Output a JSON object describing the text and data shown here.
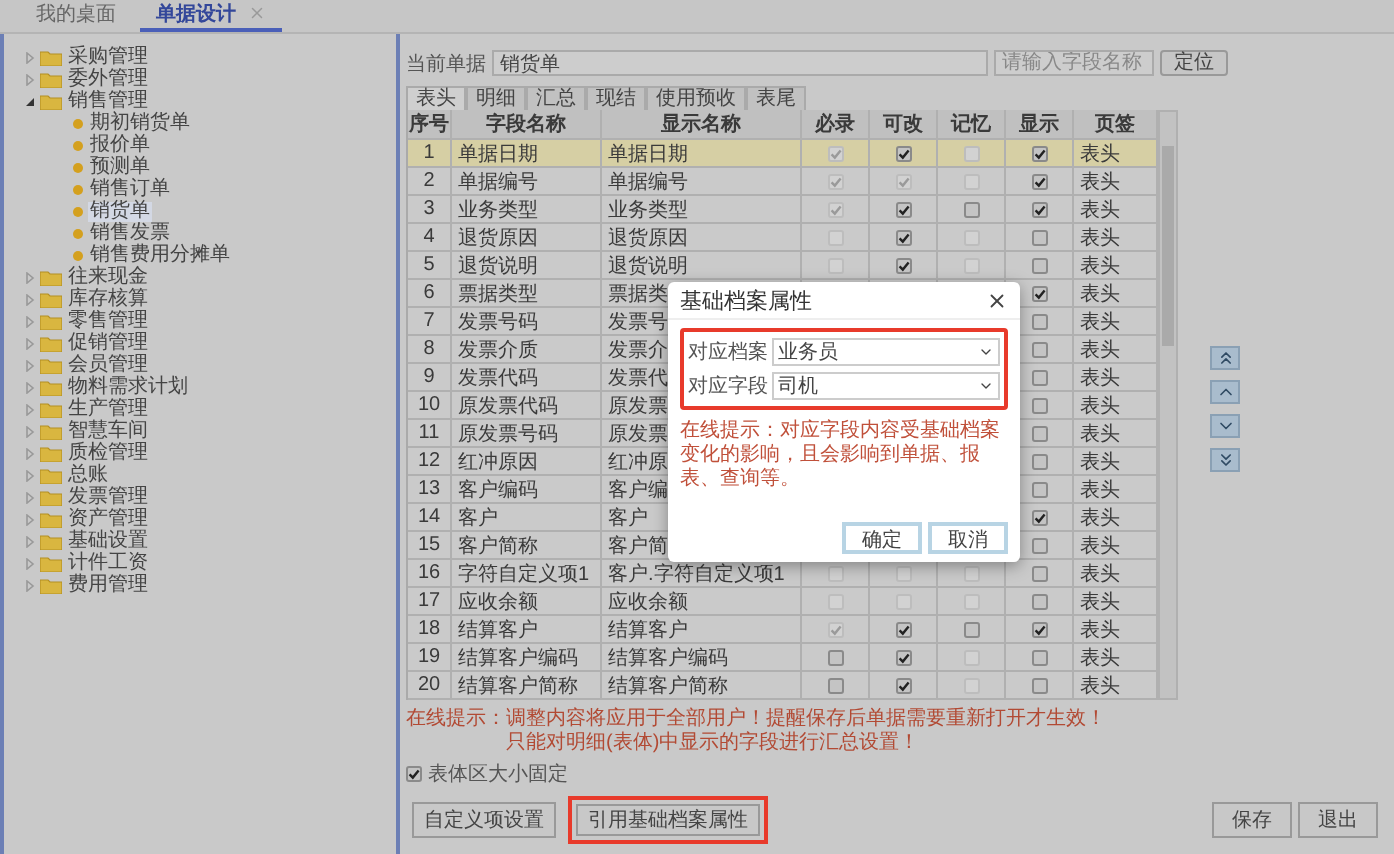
{
  "page_tabs": [
    {
      "label": "我的桌面",
      "selected": false,
      "closable": false
    },
    {
      "label": "单据设计",
      "selected": true,
      "closable": true
    }
  ],
  "tree": [
    {
      "label": "采购管理",
      "kind": "folder",
      "expanded": false
    },
    {
      "label": "委外管理",
      "kind": "folder",
      "expanded": false
    },
    {
      "label": "销售管理",
      "kind": "folder",
      "expanded": true,
      "children": [
        {
          "label": "期初销货单",
          "kind": "document",
          "selected": false
        },
        {
          "label": "报价单",
          "kind": "document",
          "selected": false
        },
        {
          "label": "预测单",
          "kind": "document",
          "selected": false
        },
        {
          "label": "销售订单",
          "kind": "document",
          "selected": false
        },
        {
          "label": "销货单",
          "kind": "document",
          "selected": true
        },
        {
          "label": "销售发票",
          "kind": "document",
          "selected": false
        },
        {
          "label": "销售费用分摊单",
          "kind": "document",
          "selected": false
        }
      ]
    },
    {
      "label": "往来现金",
      "kind": "folder",
      "expanded": false
    },
    {
      "label": "库存核算",
      "kind": "folder",
      "expanded": false
    },
    {
      "label": "零售管理",
      "kind": "folder",
      "expanded": false
    },
    {
      "label": "促销管理",
      "kind": "folder",
      "expanded": false
    },
    {
      "label": "会员管理",
      "kind": "folder",
      "expanded": false
    },
    {
      "label": "物料需求计划",
      "kind": "folder",
      "expanded": false
    },
    {
      "label": "生产管理",
      "kind": "folder",
      "expanded": false
    },
    {
      "label": "智慧车间",
      "kind": "folder",
      "expanded": false
    },
    {
      "label": "质检管理",
      "kind": "folder",
      "expanded": false
    },
    {
      "label": "总账",
      "kind": "folder",
      "expanded": false
    },
    {
      "label": "发票管理",
      "kind": "folder",
      "expanded": false
    },
    {
      "label": "资产管理",
      "kind": "folder",
      "expanded": false
    },
    {
      "label": "基础设置",
      "kind": "folder",
      "expanded": false
    },
    {
      "label": "计件工资",
      "kind": "folder",
      "expanded": false
    },
    {
      "label": "费用管理",
      "kind": "folder",
      "expanded": false
    }
  ],
  "locate": {
    "label": "当前单据",
    "value": "销货单",
    "placeholder": "请输入字段名称",
    "button": "定位"
  },
  "sub_tabs": [
    {
      "label": "表头",
      "selected": true
    },
    {
      "label": "明细",
      "selected": false
    },
    {
      "label": "汇总",
      "selected": false
    },
    {
      "label": "现结",
      "selected": false
    },
    {
      "label": "使用预收",
      "selected": false
    },
    {
      "label": "表尾",
      "selected": false
    }
  ],
  "table": {
    "columns": [
      "序号",
      "字段名称",
      "显示名称",
      "必录",
      "可改",
      "记忆",
      "显示",
      "页签"
    ],
    "rows": [
      {
        "no": "1",
        "field": "单据日期",
        "display": "单据日期",
        "selected": true,
        "required": {
          "checked": true,
          "disabled": true
        },
        "editable": {
          "checked": true,
          "disabled": false
        },
        "memory": {
          "checked": false,
          "disabled": true
        },
        "visible": {
          "checked": true,
          "disabled": false
        },
        "tab": "表头"
      },
      {
        "no": "2",
        "field": "单据编号",
        "display": "单据编号",
        "selected": false,
        "required": {
          "checked": true,
          "disabled": true
        },
        "editable": {
          "checked": true,
          "disabled": true
        },
        "memory": {
          "checked": false,
          "disabled": true
        },
        "visible": {
          "checked": true,
          "disabled": false
        },
        "tab": "表头"
      },
      {
        "no": "3",
        "field": "业务类型",
        "display": "业务类型",
        "selected": false,
        "required": {
          "checked": true,
          "disabled": true
        },
        "editable": {
          "checked": true,
          "disabled": false
        },
        "memory": {
          "checked": false,
          "disabled": false
        },
        "visible": {
          "checked": true,
          "disabled": false
        },
        "tab": "表头"
      },
      {
        "no": "4",
        "field": "退货原因",
        "display": "退货原因",
        "selected": false,
        "required": {
          "checked": false,
          "disabled": true
        },
        "editable": {
          "checked": true,
          "disabled": false
        },
        "memory": {
          "checked": false,
          "disabled": true
        },
        "visible": {
          "checked": false,
          "disabled": false
        },
        "tab": "表头"
      },
      {
        "no": "5",
        "field": "退货说明",
        "display": "退货说明",
        "selected": false,
        "required": {
          "checked": false,
          "disabled": true
        },
        "editable": {
          "checked": true,
          "disabled": false
        },
        "memory": {
          "checked": false,
          "disabled": true
        },
        "visible": {
          "checked": false,
          "disabled": false
        },
        "tab": "表头"
      },
      {
        "no": "6",
        "field": "票据类型",
        "display": "票据类",
        "selected": false,
        "visible": {
          "checked": true,
          "disabled": false
        },
        "tab": "表头"
      },
      {
        "no": "7",
        "field": "发票号码",
        "display": "发票号",
        "selected": false,
        "visible": {
          "checked": false,
          "disabled": false
        },
        "tab": "表头"
      },
      {
        "no": "8",
        "field": "发票介质",
        "display": "发票介",
        "selected": false,
        "visible": {
          "checked": false,
          "disabled": false
        },
        "tab": "表头"
      },
      {
        "no": "9",
        "field": "发票代码",
        "display": "发票代",
        "selected": false,
        "visible": {
          "checked": false,
          "disabled": false
        },
        "tab": "表头"
      },
      {
        "no": "10",
        "field": "原发票代码",
        "display": "原发票",
        "selected": false,
        "visible": {
          "checked": false,
          "disabled": false
        },
        "tab": "表头"
      },
      {
        "no": "11",
        "field": "原发票号码",
        "display": "原发票",
        "selected": false,
        "visible": {
          "checked": false,
          "disabled": false
        },
        "tab": "表头"
      },
      {
        "no": "12",
        "field": "红冲原因",
        "display": "红冲原",
        "selected": false,
        "visible": {
          "checked": false,
          "disabled": false
        },
        "tab": "表头"
      },
      {
        "no": "13",
        "field": "客户编码",
        "display": "客户编",
        "selected": false,
        "visible": {
          "checked": false,
          "disabled": false
        },
        "tab": "表头"
      },
      {
        "no": "14",
        "field": "客户",
        "display": "客户",
        "selected": false,
        "visible": {
          "checked": true,
          "disabled": false
        },
        "tab": "表头"
      },
      {
        "no": "15",
        "field": "客户简称",
        "display": "客户简",
        "selected": false,
        "visible": {
          "checked": false,
          "disabled": false
        },
        "tab": "表头"
      },
      {
        "no": "16",
        "field": "字符自定义项1",
        "display": "客户.字符自定义项1",
        "selected": false,
        "required": {
          "checked": false,
          "disabled": true
        },
        "editable": {
          "checked": false,
          "disabled": true
        },
        "memory": {
          "checked": false,
          "disabled": true
        },
        "visible": {
          "checked": false,
          "disabled": false
        },
        "tab": "表头"
      },
      {
        "no": "17",
        "field": "应收余额",
        "display": "应收余额",
        "selected": false,
        "required": {
          "checked": false,
          "disabled": true
        },
        "editable": {
          "checked": false,
          "disabled": true
        },
        "memory": {
          "checked": false,
          "disabled": true
        },
        "visible": {
          "checked": false,
          "disabled": false
        },
        "tab": "表头"
      },
      {
        "no": "18",
        "field": "结算客户",
        "display": "结算客户",
        "selected": false,
        "required": {
          "checked": true,
          "disabled": true
        },
        "editable": {
          "checked": true,
          "disabled": false
        },
        "memory": {
          "checked": false,
          "disabled": false
        },
        "visible": {
          "checked": true,
          "disabled": false
        },
        "tab": "表头"
      },
      {
        "no": "19",
        "field": "结算客户编码",
        "display": "结算客户编码",
        "selected": false,
        "required": {
          "checked": false,
          "disabled": false
        },
        "editable": {
          "checked": true,
          "disabled": false
        },
        "memory": {
          "checked": false,
          "disabled": true
        },
        "visible": {
          "checked": false,
          "disabled": false
        },
        "tab": "表头"
      },
      {
        "no": "20",
        "field": "结算客户简称",
        "display": "结算客户简称",
        "selected": false,
        "required": {
          "checked": false,
          "disabled": false
        },
        "editable": {
          "checked": true,
          "disabled": false
        },
        "memory": {
          "checked": false,
          "disabled": true
        },
        "visible": {
          "checked": false,
          "disabled": false
        },
        "tab": "表头"
      }
    ]
  },
  "hints": [
    "在线提示：调整内容将应用于全部用户！提醒保存后单据需要重新打开才生效！",
    "只能对明细(表体)中显示的字段进行汇总设置！"
  ],
  "fixed_size": {
    "label": "表体区大小固定",
    "checked": true
  },
  "left_buttons": [
    {
      "label": "自定义项设置",
      "highlighted": false
    },
    {
      "label": "引用基础档案属性",
      "highlighted": true
    }
  ],
  "right_buttons": [
    "保存",
    "退出"
  ],
  "dialog": {
    "title": "基础档案属性",
    "highlighted": true,
    "fields": [
      {
        "label": "对应档案",
        "value": "业务员"
      },
      {
        "label": "对应字段",
        "value": "司机"
      }
    ],
    "hint": "在线提示：对应字段内容受基础档案变化的影响，且会影响到单据、报表、查询等。",
    "buttons": [
      "确定",
      "取消"
    ]
  }
}
